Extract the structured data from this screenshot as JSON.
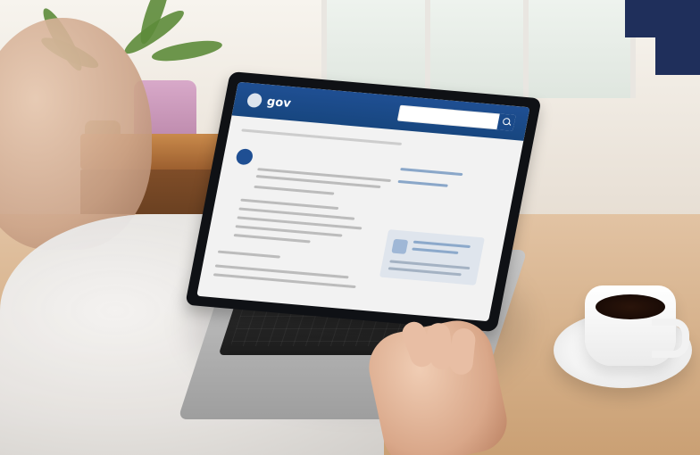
{
  "scene": {
    "caption": "",
    "colors": {
      "brand_blue": "#1f4f93",
      "corner_navy": "#1f2f5b",
      "table_wood": "#caa074",
      "coffee": "#1a0b06"
    }
  },
  "laptop_screen": {
    "site_logo_text": "gov",
    "search_placeholder": "",
    "page_title": "",
    "sidebar_links": [
      "",
      ""
    ],
    "sidebar_box_title": "",
    "icons": [
      "gov-logo-mark",
      "search-icon",
      "page-badge-icon",
      "sidebar-box-icon"
    ]
  }
}
